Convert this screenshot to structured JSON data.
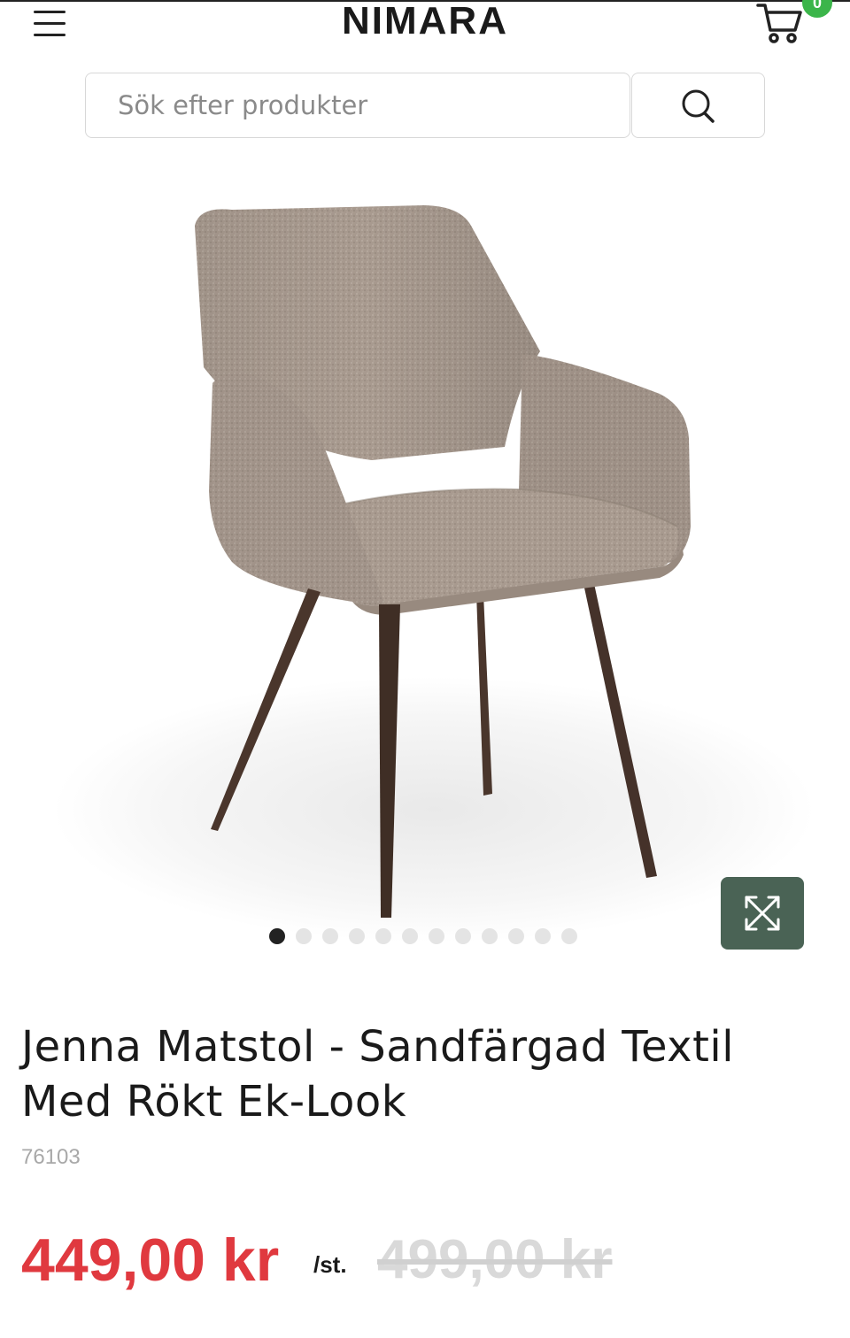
{
  "header": {
    "logo": "NIMARA",
    "cart_count": "0"
  },
  "search": {
    "placeholder": "Sök efter produkter"
  },
  "gallery": {
    "image_count": 12,
    "active_index": 0
  },
  "product": {
    "title_line1": "Jenna Matstol - Sandfärgad Textil",
    "title_line2": "Med Rökt Ek-Look",
    "sku": "76103",
    "price": "449,00 kr",
    "unit": "/st.",
    "old_price": "499,00 kr"
  },
  "colors": {
    "price": "#e0393f",
    "badge": "#3bb54a",
    "expand_button": "#4a6355",
    "fabric": "#a89a8f",
    "legs": "#4a362c"
  }
}
